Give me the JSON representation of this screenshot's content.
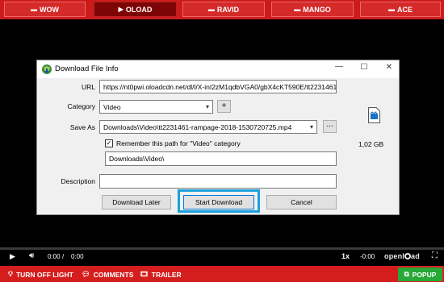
{
  "tabs": [
    {
      "icon": "server-icon",
      "label": "WOW",
      "active": false
    },
    {
      "icon": "play-icon",
      "label": "OLOAD",
      "active": true
    },
    {
      "icon": "server-icon",
      "label": "RAVID",
      "active": false
    },
    {
      "icon": "server-icon",
      "label": "MANGO",
      "active": false
    },
    {
      "icon": "server-icon",
      "label": "ACE",
      "active": false
    }
  ],
  "dialog": {
    "title": "Download File Info",
    "url_label": "URL",
    "url_value": "https://nt0pwi.oloadcdn.net/dl/l/X-inI2zM1qdbVGA0/gbX4cKT590E/tt2231461",
    "category_label": "Category",
    "category_value": "Video",
    "add_button": "+",
    "saveas_label": "Save As",
    "saveas_value": "Downloads\\Video\\tt2231461-rampage-2018-1530720725.mp4",
    "browse_button": "...",
    "remember_label": "Remember this path for \"Video\" category",
    "remember_checked": true,
    "path_value": "Downloads\\Video\\",
    "description_label": "Description",
    "description_value": "",
    "file_size": "1,02 GB",
    "download_later": "Download Later",
    "start_download": "Start Download",
    "cancel": "Cancel"
  },
  "player": {
    "current_time": "0:00",
    "separator": "/",
    "duration": "0:00",
    "speed": "1x",
    "remaining": "-0:00",
    "logo_pre": "openl",
    "logo_post": "ad"
  },
  "bottombar": {
    "light": "TURN OFF LIGHT",
    "comments": "COMMENTS",
    "trailer": "TRAILER",
    "popup": "POPUP"
  },
  "colors": {
    "accent_red": "#cc1b1b",
    "active_tab": "#7d0505",
    "popup_green": "#27a837",
    "highlight_blue": "#1b9fdc"
  }
}
